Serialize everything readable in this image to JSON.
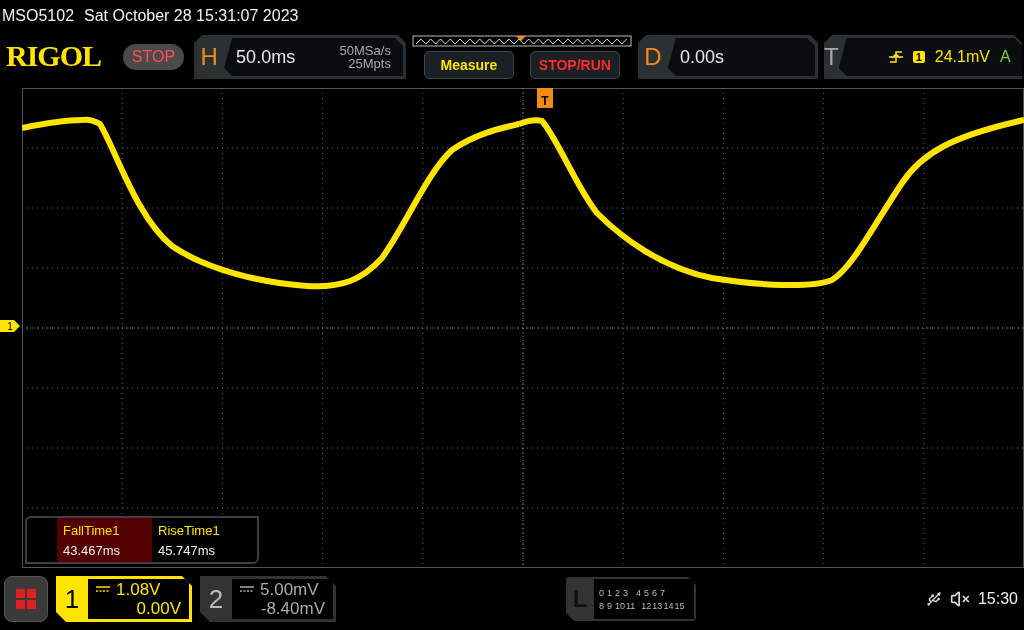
{
  "title_bar": {
    "model": "MSO5102",
    "datetime": "Sat October 28 15:31:07 2023"
  },
  "logo": "RIGOL",
  "run_state": {
    "label": "STOP",
    "running": false
  },
  "horizontal": {
    "label": "H",
    "timebase": "50.0ms",
    "sample_rate": "50MSa/s",
    "memory_depth": "25Mpts"
  },
  "buttons": [
    {
      "label": "Measure",
      "kind": "measure"
    },
    {
      "label": "STOP/RUN",
      "kind": "run"
    }
  ],
  "delay": {
    "label": "D",
    "value": "0.00s"
  },
  "trigger": {
    "label": "T",
    "source": "1",
    "level": "24.1mV",
    "mode": "A"
  },
  "markers": {
    "trigger": "T",
    "channel": "1"
  },
  "measurements": [
    {
      "name": "FallTime1",
      "value": "43.467ms",
      "selected": true
    },
    {
      "name": "RiseTime1",
      "value": "45.747ms",
      "selected": false
    }
  ],
  "channels": [
    {
      "number": "1",
      "scale": "1.08V",
      "offset": "0.00V",
      "on": true
    },
    {
      "number": "2",
      "scale": "5.00mV",
      "offset": "-8.40mV",
      "on": false
    }
  ],
  "logic": {
    "label": "L",
    "row_1": [
      "0",
      "1",
      "2",
      "3",
      "4",
      "5",
      "6",
      "7"
    ],
    "row_2": [
      "8",
      "9",
      "10",
      "11",
      "12",
      "13",
      "14",
      "15"
    ]
  },
  "status": {
    "time": "15:30",
    "muted": true
  }
}
